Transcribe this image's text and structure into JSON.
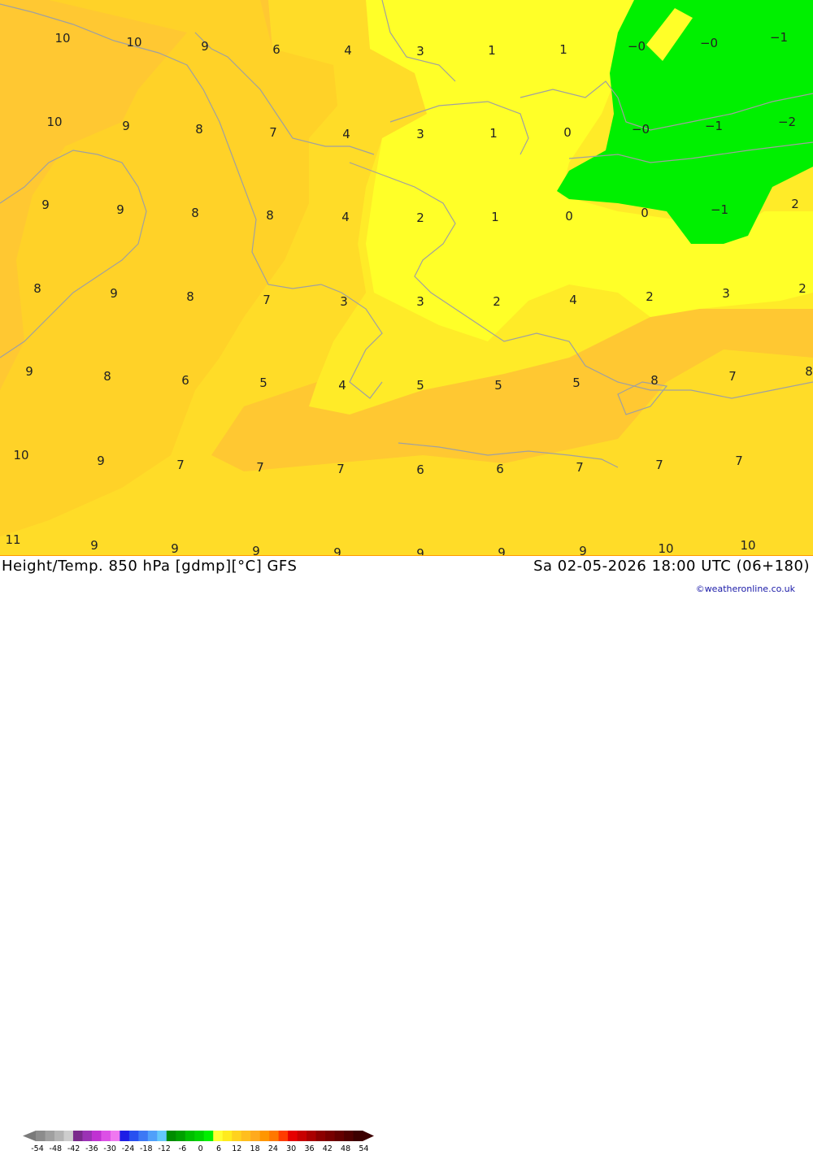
{
  "map": {
    "values": [
      {
        "t": "10"
      },
      {
        "t": "10"
      },
      {
        "t": "9"
      },
      {
        "t": "6"
      },
      {
        "t": "4"
      },
      {
        "t": "3"
      },
      {
        "t": "1"
      },
      {
        "t": "1"
      },
      {
        "t": "−0"
      },
      {
        "t": "−0"
      },
      {
        "t": "−1"
      },
      {
        "t": "10"
      },
      {
        "t": "9"
      },
      {
        "t": "8"
      },
      {
        "t": "7"
      },
      {
        "t": "4"
      },
      {
        "t": "3"
      },
      {
        "t": "1"
      },
      {
        "t": "0"
      },
      {
        "t": "−0"
      },
      {
        "t": "−1"
      },
      {
        "t": "−2"
      },
      {
        "t": "9"
      },
      {
        "t": "9"
      },
      {
        "t": "8"
      },
      {
        "t": "8"
      },
      {
        "t": "4"
      },
      {
        "t": "2"
      },
      {
        "t": "1"
      },
      {
        "t": "0"
      },
      {
        "t": "0"
      },
      {
        "t": "−1"
      },
      {
        "t": "2"
      },
      {
        "t": "8"
      },
      {
        "t": "9"
      },
      {
        "t": "8"
      },
      {
        "t": "7"
      },
      {
        "t": "3"
      },
      {
        "t": "3"
      },
      {
        "t": "2"
      },
      {
        "t": "4"
      },
      {
        "t": "2"
      },
      {
        "t": "3"
      },
      {
        "t": "2"
      },
      {
        "t": "9"
      },
      {
        "t": "8"
      },
      {
        "t": "6"
      },
      {
        "t": "5"
      },
      {
        "t": "4"
      },
      {
        "t": "5"
      },
      {
        "t": "5"
      },
      {
        "t": "5"
      },
      {
        "t": "8"
      },
      {
        "t": "7"
      },
      {
        "t": "8"
      },
      {
        "t": "10"
      },
      {
        "t": "9"
      },
      {
        "t": "7"
      },
      {
        "t": "7"
      },
      {
        "t": "7"
      },
      {
        "t": "6"
      },
      {
        "t": "6"
      },
      {
        "t": "7"
      },
      {
        "t": "7"
      },
      {
        "t": "7"
      },
      {
        "t": "11"
      },
      {
        "t": "9"
      },
      {
        "t": "9"
      },
      {
        "t": "9"
      },
      {
        "t": "9"
      },
      {
        "t": "9"
      },
      {
        "t": "9"
      },
      {
        "t": "9"
      },
      {
        "t": "10"
      },
      {
        "t": "10"
      }
    ]
  },
  "footer": {
    "title": "Height/Temp. 850 hPa [gdmp][°C] GFS",
    "date": "Sa 02-05-2026 18:00 UTC (06+180)",
    "credit": "©weatheronline.co.uk"
  },
  "legend": {
    "ticks": [
      "-54",
      "-48",
      "-42",
      "-36",
      "-30",
      "-24",
      "-18",
      "-12",
      "-6",
      "0",
      "6",
      "12",
      "18",
      "24",
      "30",
      "36",
      "42",
      "48",
      "54"
    ],
    "colors": [
      "#8c8c8c",
      "#a0a0a0",
      "#b4b4b4",
      "#cdcdcd",
      "#7a2a8c",
      "#9b32b4",
      "#c032d2",
      "#dc50e6",
      "#f078f0",
      "#1e1ee6",
      "#2850f0",
      "#3c78f5",
      "#50a0fa",
      "#64c8fa",
      "#008c00",
      "#00a000",
      "#00be00",
      "#00d200",
      "#00f000",
      "#ffff32",
      "#ffeb1e",
      "#ffd21e",
      "#ffbe1e",
      "#ffaa1e",
      "#ff9600",
      "#ff7800",
      "#ff3c00",
      "#e60000",
      "#c80000",
      "#aa0000",
      "#8c0000",
      "#780000",
      "#640000",
      "#500000",
      "#3c0000"
    ]
  }
}
